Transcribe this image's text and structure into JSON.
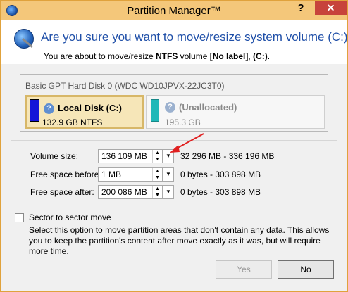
{
  "window": {
    "title": "Partition Manager™",
    "help_label": "?",
    "close_label": "✕"
  },
  "header": {
    "title": "Are you sure you want to move/resize system volume (C:)?",
    "sub_prefix": "You are about to move/resize ",
    "sub_fs": "NTFS",
    "sub_mid": " volume ",
    "sub_label": "[No label]",
    "sub_sep": ", ",
    "sub_drive": "(C:)",
    "sub_end": "."
  },
  "disk": {
    "title": "Basic GPT Hard Disk 0 (WDC WD10JPVX-22JC3T0)",
    "partitions": [
      {
        "name": "Local Disk (C:)",
        "size": "132.9 GB NTFS",
        "color": "#1414d8",
        "selected": true
      },
      {
        "name": "(Unallocated)",
        "size": "195.3 GB",
        "color": "#1fb8b8",
        "selected": false
      }
    ]
  },
  "fields": {
    "volume_size": {
      "label": "Volume size:",
      "value": "136 109 MB",
      "range": "32 296 MB - 336 196 MB"
    },
    "free_before": {
      "label": "Free space before:",
      "value": "1 MB",
      "range": "0 bytes - 303 898 MB"
    },
    "free_after": {
      "label": "Free space after:",
      "value": "200 086 MB",
      "range": "0 bytes - 303 898 MB"
    }
  },
  "sector": {
    "label": "Sector to sector move",
    "checked": false,
    "description": "Select this option to move partition areas that don't contain any data. This allows you to keep the partition's content after move exactly as it was, but will require more time."
  },
  "buttons": {
    "yes": "Yes",
    "no": "No"
  },
  "icons": {
    "spin_up": "▲",
    "spin_down": "▼",
    "dropdown": "▼",
    "question": "?"
  }
}
